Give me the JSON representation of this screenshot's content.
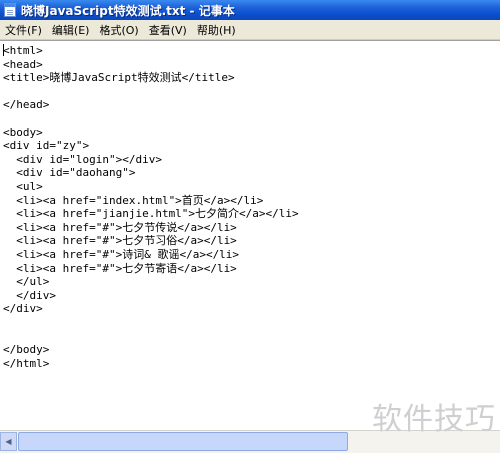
{
  "window": {
    "title": "晓博JavaScript特效测试.txt - 记事本"
  },
  "menu": [
    "文件(F)",
    "编辑(E)",
    "格式(O)",
    "查看(V)",
    "帮助(H)"
  ],
  "editor": {
    "content": "<html>\n<head>\n<title>晓博JavaScript特效测试</title>\n\n</head>\n\n<body>\n<div id=\"zy\">\n  <div id=\"login\"></div>\n  <div id=\"daohang\">\n  <ul>\n  <li><a href=\"index.html\">首页</a></li>\n  <li><a href=\"jianjie.html\">七夕简介</a></li>\n  <li><a href=\"#\">七夕节传说</a></li>\n  <li><a href=\"#\">七夕节习俗</a></li>\n  <li><a href=\"#\">诗词& 歌谣</a></li>\n  <li><a href=\"#\">七夕节寄语</a></li>\n  </ul>\n  </div>\n</div>\n\n\n</body>\n</html>"
  },
  "watermark": "软件技巧"
}
